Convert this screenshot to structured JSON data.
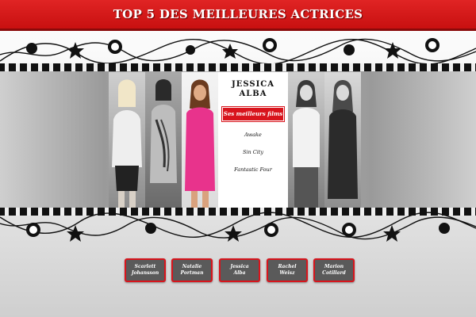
{
  "title": "TOP 5 DES MEILLEURES ACTRICES",
  "selected_actress": {
    "name": "JESSICA ALBA",
    "films_header": "Ses meilleurs films",
    "films": [
      "Awake",
      "Sin City",
      "Fantastic Four"
    ]
  },
  "buttons": [
    {
      "line1": "Scarlett",
      "line2": "Johansson"
    },
    {
      "line1": "Natalie",
      "line2": "Portman"
    },
    {
      "line1": "Jessica",
      "line2": "Alba"
    },
    {
      "line1": "Rachel",
      "line2": "Weisz"
    },
    {
      "line1": "Marion",
      "line2": "Cotillard"
    }
  ],
  "colors": {
    "accent": "#d8141c",
    "button_bg": "#5a5a5a"
  }
}
